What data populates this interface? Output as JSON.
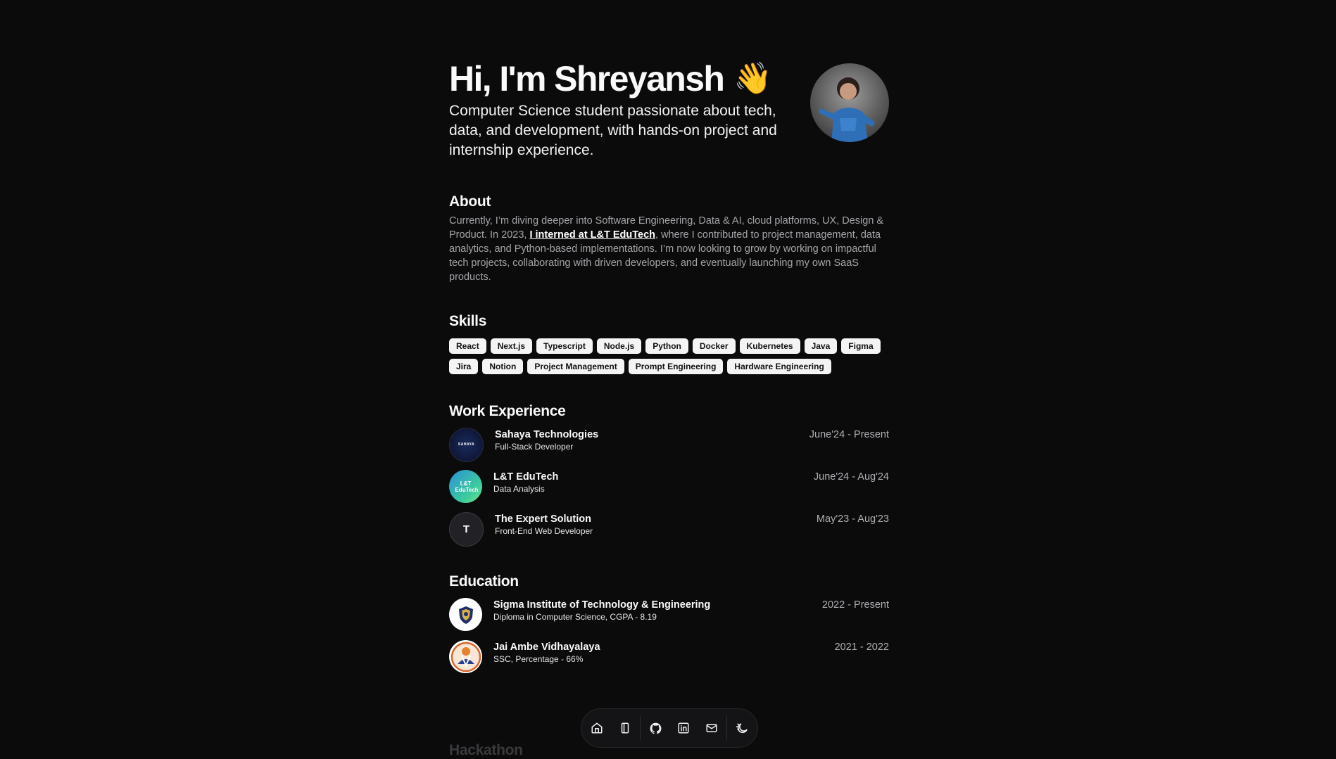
{
  "hero": {
    "title": "Hi, I'm Shreyansh",
    "wave_emoji": "👋",
    "tagline": "Computer Science student passionate about tech, data, and development, with hands-on project and internship experience.",
    "avatar_icon": "profile-photo"
  },
  "about": {
    "heading": "About",
    "text_before": "Currently, I’m diving deeper into Software Engineering, Data & AI, cloud platforms, UX, Design & Product. In 2023, ",
    "link_text": "I interned at L&T EduTech",
    "text_after": ", where I contributed to project management, data analytics, and Python-based implementations. I’m now looking to grow by working on impactful tech projects, collaborating with driven developers, and eventually launching my own SaaS products."
  },
  "skills": {
    "heading": "Skills",
    "items": [
      "React",
      "Next.js",
      "Typescript",
      "Node.js",
      "Python",
      "Docker",
      "Kubernetes",
      "Java",
      "Figma",
      "Jira",
      "Notion",
      "Project Management",
      "Prompt Engineering",
      "Hardware Engineering"
    ]
  },
  "work": {
    "heading": "Work Experience",
    "items": [
      {
        "logo_text": "SAHAYA",
        "company": "Sahaya Technologies",
        "role": "Full-Stack Developer",
        "dates": "June'24 - Present"
      },
      {
        "logo_text": "L&T EduTech",
        "company": "L&T EduTech",
        "role": "Data Analysis",
        "dates": "June'24 - Aug'24"
      },
      {
        "logo_text": "T",
        "company": "The Expert Solution",
        "role": "Front-End Web Developer",
        "dates": "May'23 - Aug'23"
      }
    ]
  },
  "education": {
    "heading": "Education",
    "items": [
      {
        "school": "Sigma Institute of Technology & Engineering",
        "degree": "Diploma in Computer Science, CGPA - 8.19",
        "dates": "2022 - Present"
      },
      {
        "school": "Jai Ambe Vidhayalaya",
        "degree": "SSC, Percentage - 66%",
        "dates": "2021 - 2022"
      }
    ]
  },
  "next_section": {
    "heading": "Hackathon"
  },
  "dock": {
    "items": [
      "home-icon",
      "notebook-icon",
      "github-icon",
      "linkedin-icon",
      "mail-icon",
      "theme-toggle-icon"
    ]
  },
  "colors": {
    "background": "#0b0b0c",
    "chip_bg": "#f4f4f5",
    "muted_text": "#a5a5a9"
  }
}
